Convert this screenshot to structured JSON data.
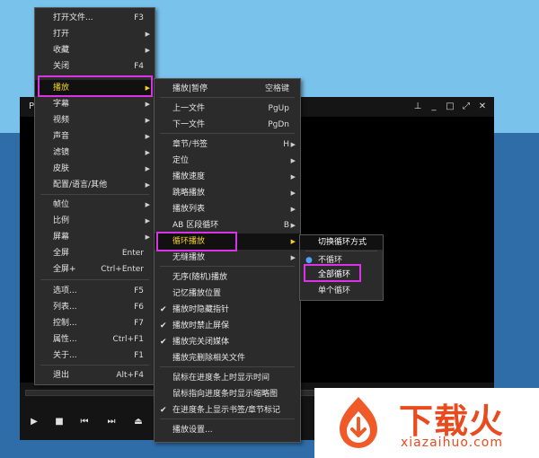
{
  "window": {
    "title": "Po"
  },
  "main_menu": [
    {
      "label": "打开文件...",
      "shortcut": "F3"
    },
    {
      "label": "打开",
      "submenu": true
    },
    {
      "label": "收藏",
      "submenu": true
    },
    {
      "label": "关闭",
      "shortcut": "F4"
    },
    {
      "label": "播放",
      "submenu": true,
      "highlighted": true
    },
    {
      "label": "字幕",
      "submenu": true
    },
    {
      "label": "视频",
      "submenu": true
    },
    {
      "label": "声音",
      "submenu": true
    },
    {
      "label": "滤镜",
      "submenu": true
    },
    {
      "label": "皮肤",
      "submenu": true
    },
    {
      "label": "配置/语言/其他",
      "submenu": true
    },
    {
      "label": "帧位",
      "submenu": true
    },
    {
      "label": "比例",
      "submenu": true
    },
    {
      "label": "屏幕",
      "submenu": true
    },
    {
      "label": "全屏",
      "shortcut": "Enter"
    },
    {
      "label": "全屏+",
      "shortcut": "Ctrl+Enter"
    },
    {
      "label": "选项...",
      "shortcut": "F5"
    },
    {
      "label": "列表...",
      "shortcut": "F6"
    },
    {
      "label": "控制...",
      "shortcut": "F7"
    },
    {
      "label": "属性...",
      "shortcut": "Ctrl+F1"
    },
    {
      "label": "关于...",
      "shortcut": "F1"
    },
    {
      "label": "退出",
      "shortcut": "Alt+F4"
    }
  ],
  "play_menu": [
    {
      "label": "播放|暂停",
      "shortcut": "空格键"
    },
    {
      "label": "上一文件",
      "shortcut": "PgUp"
    },
    {
      "label": "下一文件",
      "shortcut": "PgDn"
    },
    {
      "label": "章节/书签",
      "shortcut": "H"
    },
    {
      "label": "定位"
    },
    {
      "label": "播放速度"
    },
    {
      "label": "跳略播放"
    },
    {
      "label": "播放列表"
    },
    {
      "label": "AB 区段循环",
      "shortcut": "B"
    },
    {
      "label": "循环播放",
      "highlighted": true
    },
    {
      "label": "无缝播放"
    },
    {
      "label": "无序(随机)播放"
    },
    {
      "label": "记忆播放位置"
    },
    {
      "label": "播放时隐藏指针",
      "checked": true
    },
    {
      "label": "播放时禁止屏保",
      "checked": true
    },
    {
      "label": "播放完关闭媒体",
      "checked": true
    },
    {
      "label": "播放完删除相关文件"
    },
    {
      "label": "鼠标在进度条上时显示时间"
    },
    {
      "label": "鼠标指向进度条时显示缩略图"
    },
    {
      "label": "在进度条上显示书签/章节标记",
      "checked": true
    },
    {
      "label": "播放设置..."
    }
  ],
  "loop_menu": {
    "header": "切换循环方式",
    "items": [
      {
        "label": "不循环",
        "selected": true
      },
      {
        "label": "全部循环",
        "highlighted": true
      },
      {
        "label": "单个循环"
      }
    ]
  },
  "watermark": {
    "brand": "下载火",
    "url": "xiazaihuo.com"
  },
  "colors": {
    "accent_yellow": "#f2d22a",
    "highlight_border": "#d933e6",
    "brand": "#e94b1f",
    "radio": "#4ea3ff"
  },
  "icons": {
    "arrow": "submenu-arrow-icon",
    "check": "checkmark-icon",
    "radio": "radio-dot-icon"
  }
}
